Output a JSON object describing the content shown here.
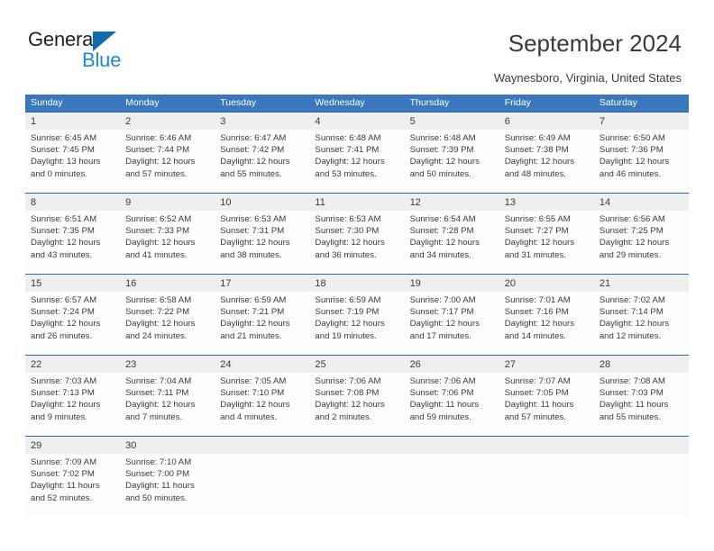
{
  "brand": {
    "name_top": "General",
    "name_bottom": "Blue",
    "accent_color": "#1269b0",
    "accent_color_light": "#1b8ade"
  },
  "header": {
    "title": "September 2024",
    "location": "Waynesboro, Virginia, United States"
  },
  "calendar": {
    "header_bg": "#3b77bc",
    "row_border_color": "#2f6aad",
    "day_band_bg": "#efefef",
    "weekdays": [
      "Sunday",
      "Monday",
      "Tuesday",
      "Wednesday",
      "Thursday",
      "Friday",
      "Saturday"
    ],
    "weeks": [
      [
        {
          "day": "1",
          "sunrise": "Sunrise: 6:45 AM",
          "sunset": "Sunset: 7:45 PM",
          "daylight_1": "Daylight: 13 hours",
          "daylight_2": "and 0 minutes."
        },
        {
          "day": "2",
          "sunrise": "Sunrise: 6:46 AM",
          "sunset": "Sunset: 7:44 PM",
          "daylight_1": "Daylight: 12 hours",
          "daylight_2": "and 57 minutes."
        },
        {
          "day": "3",
          "sunrise": "Sunrise: 6:47 AM",
          "sunset": "Sunset: 7:42 PM",
          "daylight_1": "Daylight: 12 hours",
          "daylight_2": "and 55 minutes."
        },
        {
          "day": "4",
          "sunrise": "Sunrise: 6:48 AM",
          "sunset": "Sunset: 7:41 PM",
          "daylight_1": "Daylight: 12 hours",
          "daylight_2": "and 53 minutes."
        },
        {
          "day": "5",
          "sunrise": "Sunrise: 6:48 AM",
          "sunset": "Sunset: 7:39 PM",
          "daylight_1": "Daylight: 12 hours",
          "daylight_2": "and 50 minutes."
        },
        {
          "day": "6",
          "sunrise": "Sunrise: 6:49 AM",
          "sunset": "Sunset: 7:38 PM",
          "daylight_1": "Daylight: 12 hours",
          "daylight_2": "and 48 minutes."
        },
        {
          "day": "7",
          "sunrise": "Sunrise: 6:50 AM",
          "sunset": "Sunset: 7:36 PM",
          "daylight_1": "Daylight: 12 hours",
          "daylight_2": "and 46 minutes."
        }
      ],
      [
        {
          "day": "8",
          "sunrise": "Sunrise: 6:51 AM",
          "sunset": "Sunset: 7:35 PM",
          "daylight_1": "Daylight: 12 hours",
          "daylight_2": "and 43 minutes."
        },
        {
          "day": "9",
          "sunrise": "Sunrise: 6:52 AM",
          "sunset": "Sunset: 7:33 PM",
          "daylight_1": "Daylight: 12 hours",
          "daylight_2": "and 41 minutes."
        },
        {
          "day": "10",
          "sunrise": "Sunrise: 6:53 AM",
          "sunset": "Sunset: 7:31 PM",
          "daylight_1": "Daylight: 12 hours",
          "daylight_2": "and 38 minutes."
        },
        {
          "day": "11",
          "sunrise": "Sunrise: 6:53 AM",
          "sunset": "Sunset: 7:30 PM",
          "daylight_1": "Daylight: 12 hours",
          "daylight_2": "and 36 minutes."
        },
        {
          "day": "12",
          "sunrise": "Sunrise: 6:54 AM",
          "sunset": "Sunset: 7:28 PM",
          "daylight_1": "Daylight: 12 hours",
          "daylight_2": "and 34 minutes."
        },
        {
          "day": "13",
          "sunrise": "Sunrise: 6:55 AM",
          "sunset": "Sunset: 7:27 PM",
          "daylight_1": "Daylight: 12 hours",
          "daylight_2": "and 31 minutes."
        },
        {
          "day": "14",
          "sunrise": "Sunrise: 6:56 AM",
          "sunset": "Sunset: 7:25 PM",
          "daylight_1": "Daylight: 12 hours",
          "daylight_2": "and 29 minutes."
        }
      ],
      [
        {
          "day": "15",
          "sunrise": "Sunrise: 6:57 AM",
          "sunset": "Sunset: 7:24 PM",
          "daylight_1": "Daylight: 12 hours",
          "daylight_2": "and 26 minutes."
        },
        {
          "day": "16",
          "sunrise": "Sunrise: 6:58 AM",
          "sunset": "Sunset: 7:22 PM",
          "daylight_1": "Daylight: 12 hours",
          "daylight_2": "and 24 minutes."
        },
        {
          "day": "17",
          "sunrise": "Sunrise: 6:59 AM",
          "sunset": "Sunset: 7:21 PM",
          "daylight_1": "Daylight: 12 hours",
          "daylight_2": "and 21 minutes."
        },
        {
          "day": "18",
          "sunrise": "Sunrise: 6:59 AM",
          "sunset": "Sunset: 7:19 PM",
          "daylight_1": "Daylight: 12 hours",
          "daylight_2": "and 19 minutes."
        },
        {
          "day": "19",
          "sunrise": "Sunrise: 7:00 AM",
          "sunset": "Sunset: 7:17 PM",
          "daylight_1": "Daylight: 12 hours",
          "daylight_2": "and 17 minutes."
        },
        {
          "day": "20",
          "sunrise": "Sunrise: 7:01 AM",
          "sunset": "Sunset: 7:16 PM",
          "daylight_1": "Daylight: 12 hours",
          "daylight_2": "and 14 minutes."
        },
        {
          "day": "21",
          "sunrise": "Sunrise: 7:02 AM",
          "sunset": "Sunset: 7:14 PM",
          "daylight_1": "Daylight: 12 hours",
          "daylight_2": "and 12 minutes."
        }
      ],
      [
        {
          "day": "22",
          "sunrise": "Sunrise: 7:03 AM",
          "sunset": "Sunset: 7:13 PM",
          "daylight_1": "Daylight: 12 hours",
          "daylight_2": "and 9 minutes."
        },
        {
          "day": "23",
          "sunrise": "Sunrise: 7:04 AM",
          "sunset": "Sunset: 7:11 PM",
          "daylight_1": "Daylight: 12 hours",
          "daylight_2": "and 7 minutes."
        },
        {
          "day": "24",
          "sunrise": "Sunrise: 7:05 AM",
          "sunset": "Sunset: 7:10 PM",
          "daylight_1": "Daylight: 12 hours",
          "daylight_2": "and 4 minutes."
        },
        {
          "day": "25",
          "sunrise": "Sunrise: 7:06 AM",
          "sunset": "Sunset: 7:08 PM",
          "daylight_1": "Daylight: 12 hours",
          "daylight_2": "and 2 minutes."
        },
        {
          "day": "26",
          "sunrise": "Sunrise: 7:06 AM",
          "sunset": "Sunset: 7:06 PM",
          "daylight_1": "Daylight: 11 hours",
          "daylight_2": "and 59 minutes."
        },
        {
          "day": "27",
          "sunrise": "Sunrise: 7:07 AM",
          "sunset": "Sunset: 7:05 PM",
          "daylight_1": "Daylight: 11 hours",
          "daylight_2": "and 57 minutes."
        },
        {
          "day": "28",
          "sunrise": "Sunrise: 7:08 AM",
          "sunset": "Sunset: 7:03 PM",
          "daylight_1": "Daylight: 11 hours",
          "daylight_2": "and 55 minutes."
        }
      ],
      [
        {
          "day": "29",
          "sunrise": "Sunrise: 7:09 AM",
          "sunset": "Sunset: 7:02 PM",
          "daylight_1": "Daylight: 11 hours",
          "daylight_2": "and 52 minutes."
        },
        {
          "day": "30",
          "sunrise": "Sunrise: 7:10 AM",
          "sunset": "Sunset: 7:00 PM",
          "daylight_1": "Daylight: 11 hours",
          "daylight_2": "and 50 minutes."
        },
        {
          "day": "",
          "sunrise": "",
          "sunset": "",
          "daylight_1": "",
          "daylight_2": ""
        },
        {
          "day": "",
          "sunrise": "",
          "sunset": "",
          "daylight_1": "",
          "daylight_2": ""
        },
        {
          "day": "",
          "sunrise": "",
          "sunset": "",
          "daylight_1": "",
          "daylight_2": ""
        },
        {
          "day": "",
          "sunrise": "",
          "sunset": "",
          "daylight_1": "",
          "daylight_2": ""
        },
        {
          "day": "",
          "sunrise": "",
          "sunset": "",
          "daylight_1": "",
          "daylight_2": ""
        }
      ]
    ]
  }
}
